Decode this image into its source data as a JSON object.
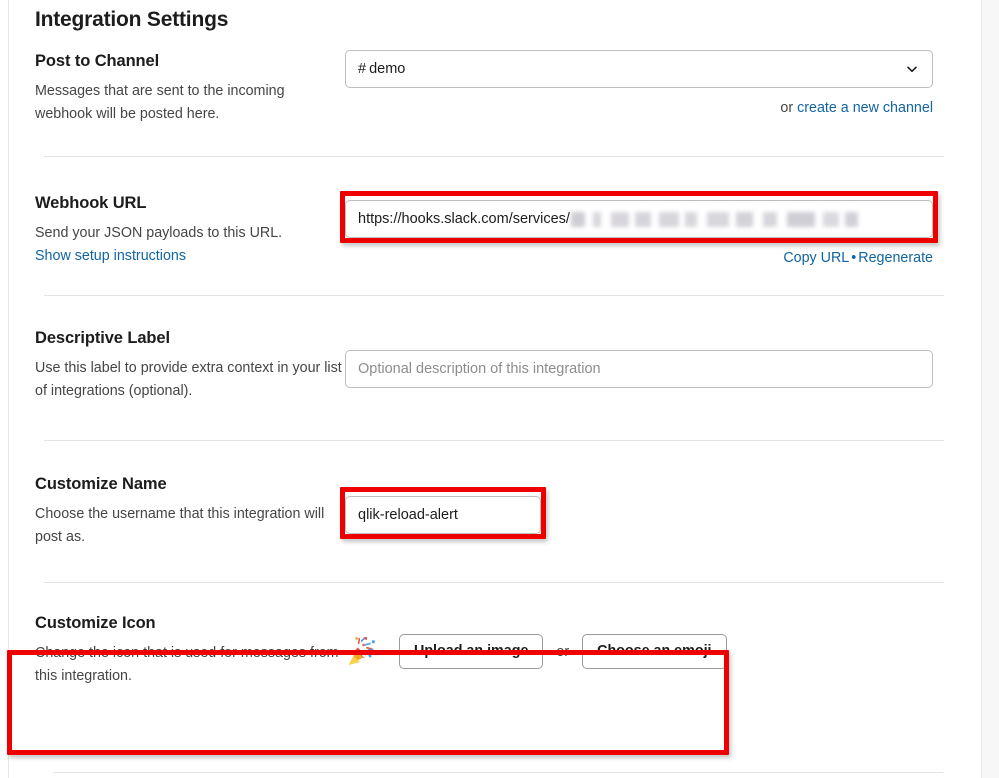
{
  "page": {
    "title": "Integration Settings"
  },
  "sections": {
    "post_to_channel": {
      "title": "Post to Channel",
      "description": "Messages that are sent to the incoming webhook will be posted here.",
      "select_hash": "#",
      "select_value": "demo",
      "chevron_icon": "chevron-down-icon",
      "or_prefix": "or ",
      "create_channel_link": "create a new channel"
    },
    "webhook_url": {
      "title": "Webhook URL",
      "description": "Send your JSON payloads to this URL.",
      "setup_link": "Show setup instructions",
      "url_value": "https://hooks.slack.com/services/",
      "url_redacted_note": "redacted",
      "copy_link": "Copy URL",
      "separator": "•",
      "regenerate_link": "Regenerate"
    },
    "descriptive_label": {
      "title": "Descriptive Label",
      "description": "Use this label to provide extra context in your list of integrations (optional).",
      "input_value": "",
      "input_placeholder": "Optional description of this integration"
    },
    "customize_name": {
      "title": "Customize Name",
      "description": "Choose the username that this integration will post as.",
      "input_value": "qlik-reload-alert",
      "input_placeholder": ""
    },
    "customize_icon": {
      "title": "Customize Icon",
      "description": "Change the icon that is used for messages from this integration.",
      "current_icon": "party-popper-emoji",
      "upload_button": "Upload an image",
      "or_label": "or",
      "emoji_button": "Choose an emoji"
    }
  },
  "colors": {
    "highlight": "#ee0000",
    "link": "#1264a3",
    "text": "#1d1c1d",
    "muted": "#454545",
    "placeholder": "#8d8d8d",
    "divider": "#e4e4e6",
    "border": "#bdbdbd"
  }
}
